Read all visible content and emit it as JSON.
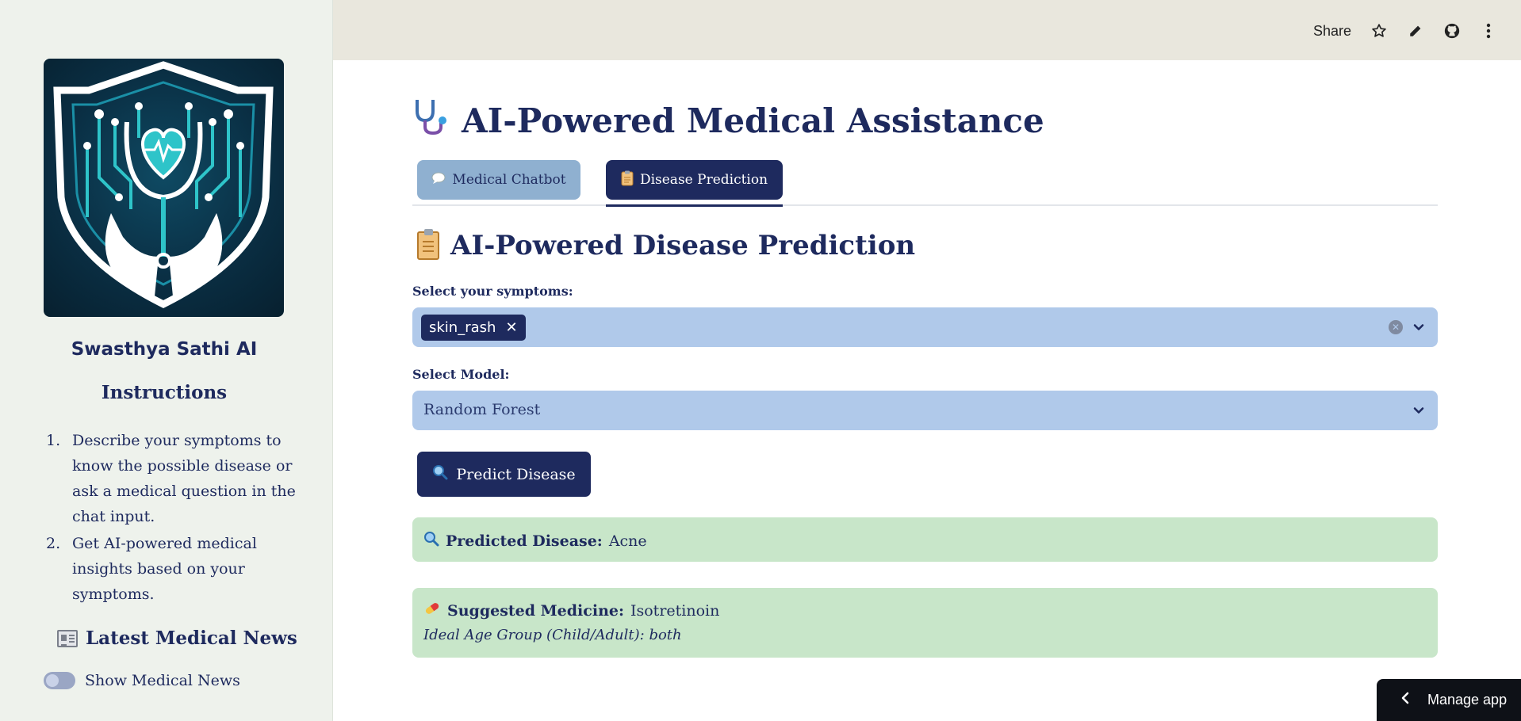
{
  "sidebar": {
    "app_name": "Swasthya Sathi AI",
    "instructions_title": "Instructions",
    "instructions": [
      {
        "num": "1.",
        "text": "Describe your symptoms to know the possible disease or ask a medical question in the chat input."
      },
      {
        "num": "2.",
        "text": "Get AI-powered medical insights based on your symptoms."
      }
    ],
    "news_title": "Latest Medical News",
    "news_toggle_label": "Show Medical News",
    "news_toggle_on": false
  },
  "header": {
    "share_label": "Share",
    "icons": [
      "star-icon",
      "pencil-icon",
      "github-icon",
      "more-vertical-icon"
    ]
  },
  "main": {
    "title": "AI-Powered Medical Assistance",
    "tabs": [
      {
        "label": "Medical Chatbot",
        "icon": "speech-bubble-icon",
        "active": false
      },
      {
        "label": "Disease Prediction",
        "icon": "clipboard-icon",
        "active": true
      }
    ],
    "section_title": "AI-Powered Disease Prediction",
    "symptoms_label": "Select your symptoms:",
    "selected_symptoms": [
      "skin_rash"
    ],
    "model_label": "Select Model:",
    "model_value": "Random Forest",
    "predict_button": "Predict Disease",
    "prediction": {
      "label": "Predicted Disease:",
      "value": "Acne"
    },
    "medicine": {
      "label": "Suggested Medicine:",
      "value": "Isotretinoin",
      "age_group": "Ideal Age Group (Child/Adult): both"
    }
  },
  "footer": {
    "manage_app": "Manage app"
  },
  "colors": {
    "primary": "#1e2a5e",
    "select_bg": "#b0c9ea",
    "tab_inactive": "#8fb0d0",
    "success_bg": "#c8e6c9",
    "sidebar_bg": "#eef2ec",
    "header_bg": "#e9e7dd"
  }
}
